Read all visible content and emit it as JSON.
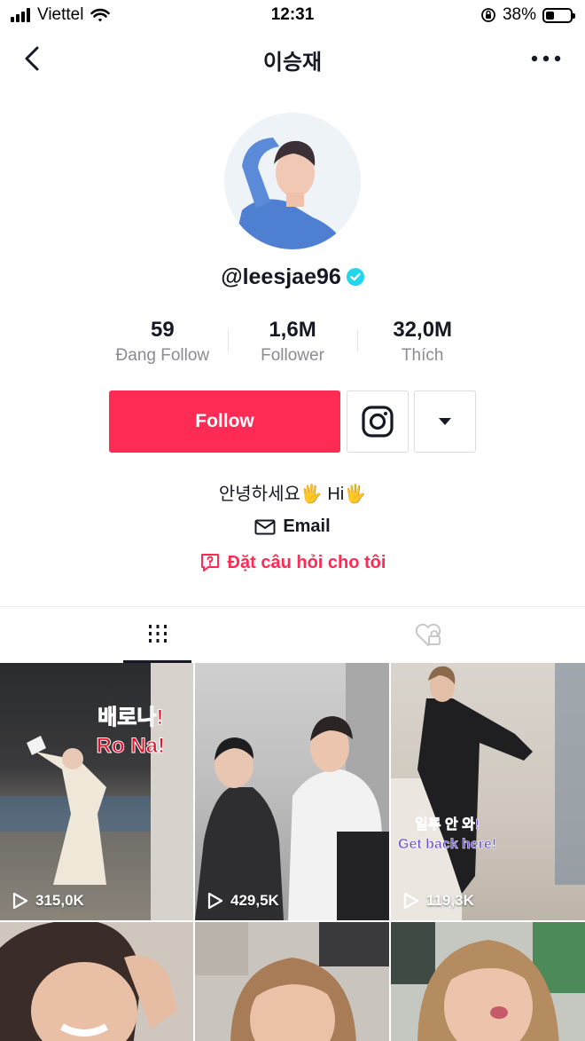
{
  "status_bar": {
    "carrier": "Viettel",
    "time": "12:31",
    "battery": "38%",
    "battery_level": 0.38
  },
  "header": {
    "title": "이승재",
    "back_icon": "chevron-left-icon",
    "more_icon": "more-horizontal-icon"
  },
  "profile": {
    "username": "@leesjae96",
    "verified": true,
    "stats": [
      {
        "value": "59",
        "label": "Đang Follow"
      },
      {
        "value": "1,6M",
        "label": "Follower"
      },
      {
        "value": "32,0M",
        "label": "Thích"
      }
    ],
    "follow_label": "Follow",
    "bio": "안녕하세요🖐 Hi🖐",
    "email_label": "Email",
    "qa_label": "Đặt câu hỏi cho tôi"
  },
  "tabs": [
    {
      "name": "videos",
      "icon": "grid-icon",
      "active": true
    },
    {
      "name": "liked",
      "icon": "heart-hidden-icon",
      "active": false
    }
  ],
  "videos": [
    {
      "views": "315,0K",
      "caption_lines": [
        "배로나!",
        "Ro Na!"
      ]
    },
    {
      "views": "429,5K"
    },
    {
      "views": "119,3K",
      "caption_lines": [
        "일루 안 와!",
        "Get back here!"
      ]
    },
    {},
    {},
    {}
  ],
  "colors": {
    "accent": "#fe2c55",
    "verified": "#20d5ec",
    "text": "#161823",
    "muted": "#8a8b91"
  }
}
